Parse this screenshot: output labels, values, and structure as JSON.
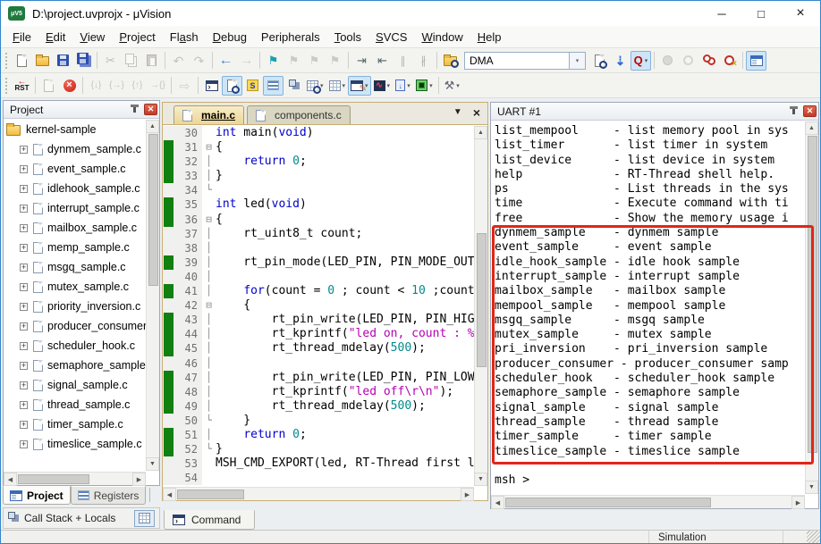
{
  "window": {
    "title": "D:\\project.uvprojx - μVision",
    "logo_text": "μV5",
    "controls": {
      "minimize": "─",
      "maximize": "□",
      "close": "×"
    }
  },
  "menu_bar": {
    "items": [
      {
        "label": "File",
        "accel": 0
      },
      {
        "label": "Edit",
        "accel": 0
      },
      {
        "label": "View",
        "accel": 0
      },
      {
        "label": "Project",
        "accel": 0
      },
      {
        "label": "Flash",
        "accel": 2
      },
      {
        "label": "Debug",
        "accel": 0
      },
      {
        "label": "Peripherals",
        "accel": -1
      },
      {
        "label": "Tools",
        "accel": 0
      },
      {
        "label": "SVCS",
        "accel": 0
      },
      {
        "label": "Window",
        "accel": 0
      },
      {
        "label": "Help",
        "accel": 0
      }
    ]
  },
  "toolbars": {
    "search_value": "DMA",
    "row1": [
      {
        "type": "grip"
      },
      {
        "name": "new-file-icon",
        "cls": "i-page"
      },
      {
        "name": "open-file-icon",
        "cls": "i-folder"
      },
      {
        "name": "save-icon",
        "cls": "i-floppy"
      },
      {
        "name": "save-all-icon",
        "cls": "i-floppy2"
      },
      {
        "type": "sep"
      },
      {
        "name": "cut-icon",
        "glyph": "✂",
        "color": "#777",
        "fs": 13,
        "dis": true
      },
      {
        "name": "copy-icon",
        "cls": "i-pages",
        "dis": true
      },
      {
        "name": "paste-icon",
        "cls": "i-clip",
        "dis": true
      },
      {
        "type": "sep"
      },
      {
        "name": "undo-icon",
        "glyph": "↶",
        "color": "#888",
        "fs": 14,
        "dis": true
      },
      {
        "name": "redo-icon",
        "glyph": "↷",
        "color": "#888",
        "fs": 14,
        "dis": true
      },
      {
        "type": "sep"
      },
      {
        "name": "navigate-back-icon",
        "glyph": "←",
        "color": "#4a7fd4",
        "fs": 16,
        "bold": true
      },
      {
        "name": "navigate-forward-icon",
        "glyph": "→",
        "color": "#aaa",
        "fs": 16,
        "bold": true,
        "dis": true
      },
      {
        "type": "sep"
      },
      {
        "name": "bookmark-toggle-icon",
        "glyph": "⚑",
        "color": "#18a0ae",
        "fs": 13
      },
      {
        "name": "bookmark-prev-icon",
        "glyph": "⚑",
        "color": "#999",
        "fs": 13,
        "dis": true
      },
      {
        "name": "bookmark-next-icon",
        "glyph": "⚑",
        "color": "#999",
        "fs": 13,
        "dis": true
      },
      {
        "name": "bookmark-clear-icon",
        "glyph": "⚑",
        "color": "#999",
        "fs": 13,
        "dis": true
      },
      {
        "type": "sep"
      },
      {
        "name": "indent-icon",
        "glyph": "⇥",
        "color": "#566",
        "fs": 13
      },
      {
        "name": "outdent-icon",
        "glyph": "⇤",
        "color": "#566",
        "fs": 13
      },
      {
        "name": "comment-icon",
        "glyph": "∥",
        "color": "#667",
        "fs": 12,
        "dis": true
      },
      {
        "name": "uncomment-icon",
        "glyph": "∦",
        "color": "#667",
        "fs": 12,
        "dis": true
      },
      {
        "type": "sep"
      },
      {
        "name": "find-in-files-icon",
        "cls": "i-folder-mag"
      },
      {
        "type": "combo",
        "name": "search-input"
      },
      {
        "name": "find-icon",
        "cls": "i-page-mag"
      },
      {
        "name": "incremental-find-icon",
        "glyph": "⇣",
        "color": "#2b6bd4",
        "fs": 14,
        "bold": true
      },
      {
        "name": "word-search-icon",
        "glyph": "Q",
        "color": "#c00000",
        "fs": 13,
        "bold": true,
        "hl": true,
        "dd": true
      },
      {
        "type": "sep"
      },
      {
        "name": "insert-breakpoint-icon",
        "cls": "i-bp-solid",
        "dis": true
      },
      {
        "name": "enable-breakpoint-icon",
        "cls": "i-bp-o",
        "dis": true
      },
      {
        "name": "disable-all-breakpoints-icon",
        "cls": "i-bp2"
      },
      {
        "name": "kill-all-breakpoints-icon",
        "cls": "i-bpkill"
      },
      {
        "type": "sep"
      },
      {
        "name": "project-window-icon",
        "cls": "i-projwin",
        "hl": true
      }
    ],
    "row2": [
      {
        "type": "grip"
      },
      {
        "name": "reset-icon",
        "cls": "i-rst",
        "text": "RST",
        "arrow": "←"
      },
      {
        "type": "sep"
      },
      {
        "name": "run-icon",
        "cls": "i-page",
        "dis": true
      },
      {
        "name": "stop-icon",
        "cls": "i-stopx"
      },
      {
        "type": "sep"
      },
      {
        "name": "step-into-icon",
        "glyph": "{↓}",
        "color": "#889",
        "fs": 10,
        "dis": true
      },
      {
        "name": "step-over-icon",
        "glyph": "{→}",
        "color": "#889",
        "fs": 10,
        "dis": true
      },
      {
        "name": "step-out-icon",
        "glyph": "{↑}",
        "color": "#889",
        "fs": 10,
        "dis": true
      },
      {
        "name": "run-to-cursor-icon",
        "glyph": "→{}",
        "color": "#889",
        "fs": 10,
        "dis": true
      },
      {
        "type": "sep"
      },
      {
        "name": "show-next-statement-icon",
        "glyph": "⇨",
        "color": "#9aa",
        "fs": 14,
        "dis": true
      },
      {
        "type": "sep"
      },
      {
        "name": "command-window-icon",
        "cls": "i-console"
      },
      {
        "name": "disassembly-window-icon",
        "cls": "i-page-mag",
        "hl": true
      },
      {
        "name": "symbols-window-icon",
        "cls": "i-sym"
      },
      {
        "name": "registers-window-icon",
        "cls": "i-lines",
        "hl": true
      },
      {
        "name": "call-stack-window-icon",
        "cls": "i-stack"
      },
      {
        "name": "watch-window-icon",
        "cls": "i-grid-mag",
        "dd": true
      },
      {
        "name": "memory-window-icon",
        "cls": "i-grid",
        "dd": true
      },
      {
        "name": "serial-window-icon",
        "cls": "i-consolepen",
        "hl": true,
        "dd": true
      },
      {
        "name": "logic-analyzer-icon",
        "cls": "i-wave",
        "dd": true
      },
      {
        "name": "system-viewer-icon",
        "cls": "i-sysv",
        "dd": true
      },
      {
        "name": "toolbox-icon",
        "cls": "i-chip",
        "dd": true
      },
      {
        "type": "sep"
      },
      {
        "name": "debug-settings-icon",
        "glyph": "⚒",
        "color": "#667",
        "fs": 13,
        "dd": true
      }
    ]
  },
  "project_panel": {
    "title": "Project",
    "root": "kernel-sample",
    "files": [
      "dynmem_sample.c",
      "event_sample.c",
      "idlehook_sample.c",
      "interrupt_sample.c",
      "mailbox_sample.c",
      "memp_sample.c",
      "msgq_sample.c",
      "mutex_sample.c",
      "priority_inversion.c",
      "producer_consumer.c",
      "scheduler_hook.c",
      "semaphore_sample.c",
      "signal_sample.c",
      "thread_sample.c",
      "timer_sample.c",
      "timeslice_sample.c"
    ]
  },
  "editor": {
    "tabs": [
      {
        "label": "main.c",
        "active": true
      },
      {
        "label": "components.c",
        "active": false
      }
    ],
    "lines": [
      {
        "n": 30,
        "g": 0,
        "f": "",
        "s": [
          [
            "k",
            "int"
          ],
          [
            "p",
            " main("
          ],
          [
            "k",
            "void"
          ],
          [
            "p",
            ")"
          ]
        ]
      },
      {
        "n": 31,
        "g": 1,
        "f": "s",
        "s": [
          [
            "p",
            "{"
          ]
        ]
      },
      {
        "n": 32,
        "g": 1,
        "f": "m",
        "s": [
          [
            "p",
            "    "
          ],
          [
            "k",
            "return"
          ],
          [
            "p",
            " "
          ],
          [
            "n",
            "0"
          ],
          [
            "p",
            ";"
          ]
        ]
      },
      {
        "n": 33,
        "g": 1,
        "f": "m",
        "s": [
          [
            "p",
            "}"
          ]
        ]
      },
      {
        "n": 34,
        "g": 0,
        "f": "e",
        "s": []
      },
      {
        "n": 35,
        "g": 1,
        "f": "",
        "s": [
          [
            "k",
            "int"
          ],
          [
            "p",
            " led("
          ],
          [
            "k",
            "void"
          ],
          [
            "p",
            ")"
          ]
        ]
      },
      {
        "n": 36,
        "g": 1,
        "f": "s",
        "s": [
          [
            "p",
            "{"
          ]
        ]
      },
      {
        "n": 37,
        "g": 0,
        "f": "m",
        "s": [
          [
            "p",
            "    rt_uint8_t count;"
          ]
        ]
      },
      {
        "n": 38,
        "g": 0,
        "f": "m",
        "s": []
      },
      {
        "n": 39,
        "g": 1,
        "f": "m",
        "s": [
          [
            "p",
            "    rt_pin_mode(LED_PIN, PIN_MODE_OUTPUT);"
          ]
        ]
      },
      {
        "n": 40,
        "g": 0,
        "f": "m",
        "s": []
      },
      {
        "n": 41,
        "g": 1,
        "f": "m",
        "s": [
          [
            "p",
            "    "
          ],
          [
            "k",
            "for"
          ],
          [
            "p",
            "(count = "
          ],
          [
            "n",
            "0"
          ],
          [
            "p",
            " ; count < "
          ],
          [
            "n",
            "10"
          ],
          [
            "p",
            " ;count++)"
          ]
        ]
      },
      {
        "n": 42,
        "g": 0,
        "f": "s",
        "s": [
          [
            "p",
            "    {"
          ]
        ]
      },
      {
        "n": 43,
        "g": 1,
        "f": "m",
        "s": [
          [
            "p",
            "        rt_pin_write(LED_PIN, PIN_HIGH);"
          ]
        ]
      },
      {
        "n": 44,
        "g": 1,
        "f": "m",
        "s": [
          [
            "p",
            "        rt_kprintf("
          ],
          [
            "t",
            "\"led on, count : %d\\r\\n\""
          ],
          [
            "p",
            ", count);"
          ]
        ]
      },
      {
        "n": 45,
        "g": 1,
        "f": "m",
        "s": [
          [
            "p",
            "        rt_thread_mdelay("
          ],
          [
            "n",
            "500"
          ],
          [
            "p",
            ");"
          ]
        ]
      },
      {
        "n": 46,
        "g": 0,
        "f": "m",
        "s": []
      },
      {
        "n": 47,
        "g": 1,
        "f": "m",
        "s": [
          [
            "p",
            "        rt_pin_write(LED_PIN, PIN_LOW);"
          ]
        ]
      },
      {
        "n": 48,
        "g": 1,
        "f": "m",
        "s": [
          [
            "p",
            "        rt_kprintf("
          ],
          [
            "t",
            "\"led off\\r\\n\""
          ],
          [
            "p",
            ");"
          ]
        ]
      },
      {
        "n": 49,
        "g": 1,
        "f": "m",
        "s": [
          [
            "p",
            "        rt_thread_mdelay("
          ],
          [
            "n",
            "500"
          ],
          [
            "p",
            ");"
          ]
        ]
      },
      {
        "n": 50,
        "g": 0,
        "f": "e",
        "s": [
          [
            "p",
            "    }"
          ]
        ]
      },
      {
        "n": 51,
        "g": 1,
        "f": "m",
        "s": [
          [
            "p",
            "    "
          ],
          [
            "k",
            "return"
          ],
          [
            "p",
            " "
          ],
          [
            "n",
            "0"
          ],
          [
            "p",
            ";"
          ]
        ]
      },
      {
        "n": 52,
        "g": 1,
        "f": "e",
        "s": [
          [
            "p",
            "}"
          ]
        ]
      },
      {
        "n": 53,
        "g": 0,
        "f": "",
        "s": [
          [
            "p",
            "MSH_CMD_EXPORT(led, RT-Thread first led sample);"
          ]
        ]
      },
      {
        "n": 54,
        "g": 0,
        "f": "",
        "s": []
      }
    ]
  },
  "uart_panel": {
    "title": "UART #1",
    "highlight_color": "#e02618",
    "highlight_start": 7,
    "highlight_end": 22,
    "lines": [
      "list_mempool     - list memory pool in sys",
      "list_timer       - list timer in system",
      "list_device      - list device in system",
      "help             - RT-Thread shell help.",
      "ps               - List threads in the sys",
      "time             - Execute command with ti",
      "free             - Show the memory usage i",
      "dynmem_sample    - dynmem sample",
      "event_sample     - event sample",
      "idle_hook_sample - idle hook sample",
      "interrupt_sample - interrupt sample",
      "mailbox_sample   - mailbox sample",
      "mempool_sample   - mempool sample",
      "msgq_sample      - msgq sample",
      "mutex_sample     - mutex sample",
      "pri_inversion    - pri_inversion sample",
      "producer_consumer - producer_consumer samp",
      "scheduler_hook   - scheduler_hook sample",
      "semaphore_sample - semaphore sample",
      "signal_sample    - signal sample",
      "thread_sample    - thread sample",
      "timer_sample     - timer sample",
      "timeslice_sample - timeslice sample",
      "",
      "msh >"
    ]
  },
  "bottom": {
    "project_tab": "Project",
    "registers_tab": "Registers",
    "call_stack": "Call Stack + Locals",
    "command_tab": "Command"
  },
  "status_bar": {
    "mode": "Simulation"
  },
  "colors": {
    "keyword": "#0000cd",
    "number": "#008b8b",
    "string": "#b400b4",
    "coverage_green": "#108010",
    "annotation_red": "#e02618",
    "window_border": "#3286cc"
  }
}
